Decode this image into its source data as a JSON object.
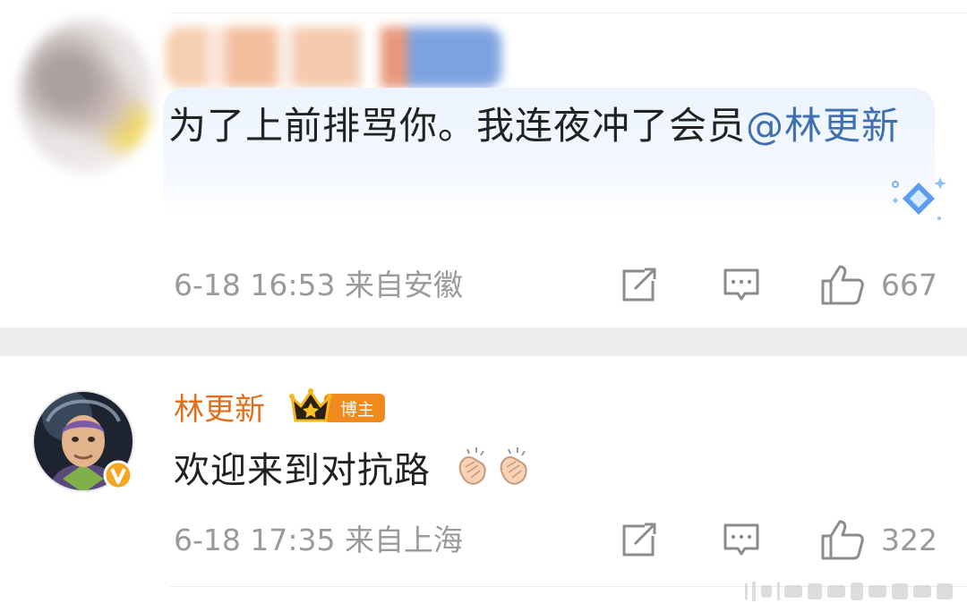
{
  "comment1": {
    "text": "为了上前排骂你。我连夜冲了会员",
    "mention": "@林更新",
    "time_location": "6-18 16:53 来自安徽",
    "likes": "667"
  },
  "reply": {
    "author": "林更新",
    "badge_label": "博主",
    "text": "欢迎来到对抗路",
    "time_location": "6-18 17:35 来自上海",
    "likes": "322"
  },
  "colors": {
    "mention": "#3f6faf",
    "author": "#e26f1b",
    "meta": "#9a9a9a",
    "bubble": "#edf4ff"
  },
  "icons": [
    "gem-icon",
    "share-icon",
    "reply-icon",
    "thumbs-up-icon",
    "crown-icon",
    "verified-icon",
    "clap-icon"
  ]
}
